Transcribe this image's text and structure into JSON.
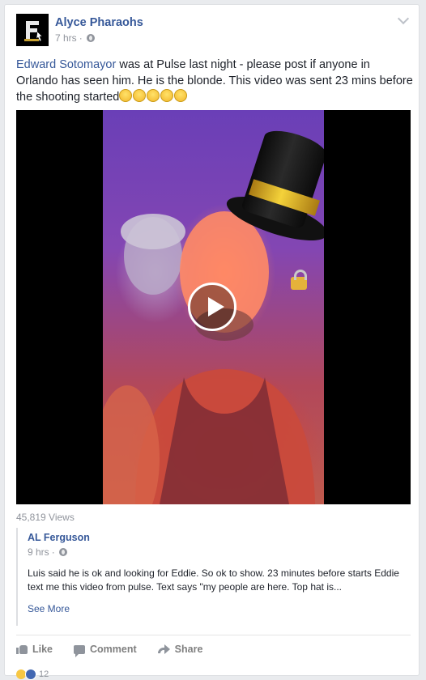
{
  "post": {
    "author": "Alyce Pharaohs",
    "time": "7 hrs",
    "separator": "·",
    "text": {
      "mention": "Edward Sotomayor",
      "body": " was at Pulse last night - please post if anyone in Orlando has seen him. He is the blonde. This video was sent 23 mins before the shooting started"
    },
    "video": {
      "views": "45,819 Views"
    }
  },
  "shared": {
    "author": "AL Ferguson",
    "time": "9 hrs",
    "separator": "·",
    "text": "Luis said he is ok and looking for Eddie. So ok to show. 23 minutes before starts Eddie text me this video from pulse. Text says \"my people are here. Top hat is...",
    "see_more": "See More"
  },
  "actions": {
    "like": "Like",
    "comment": "Comment",
    "share": "Share"
  },
  "reactions": {
    "count": "12"
  },
  "icons": {
    "audience": "globe-icon",
    "menu": "chevron-down-icon",
    "play": "play-icon",
    "like": "thumbs-up-icon",
    "comment": "comment-icon",
    "share": "share-arrow-icon",
    "emoji": "fearful-face-emoji"
  }
}
